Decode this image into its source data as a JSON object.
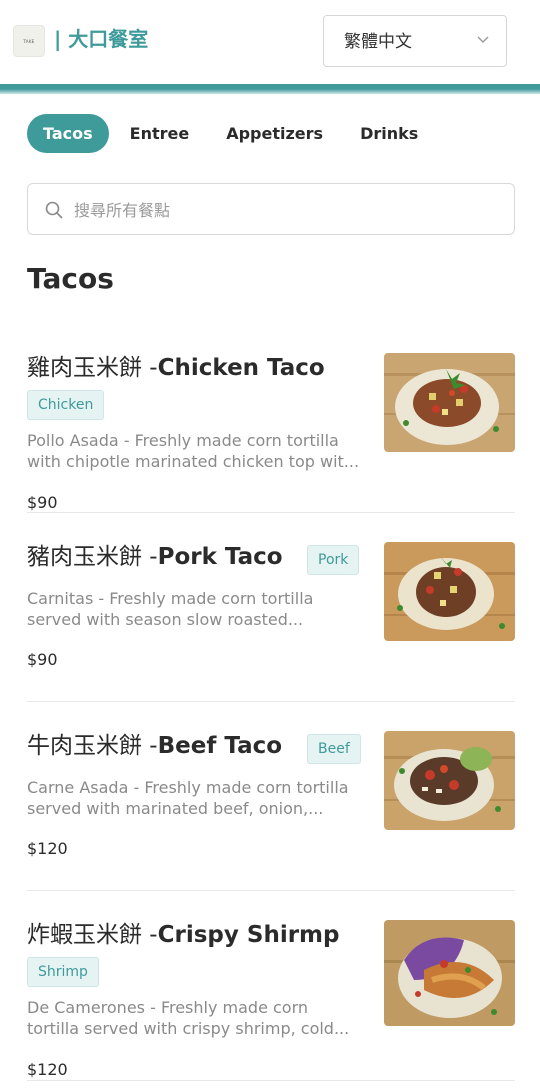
{
  "header": {
    "logo_text": "TAKE",
    "brand": "| 大口餐室",
    "language": "繁體中文"
  },
  "tabs": [
    {
      "label": "Tacos",
      "active": true
    },
    {
      "label": "Entree",
      "active": false
    },
    {
      "label": "Appetizers",
      "active": false
    },
    {
      "label": "Drinks",
      "active": false
    }
  ],
  "search": {
    "placeholder": "搜尋所有餐點",
    "value": ""
  },
  "section": {
    "title": "Tacos"
  },
  "items": [
    {
      "name_zh": "雞肉玉米餅 -",
      "name_en": "Chicken Taco",
      "tag": "Chicken",
      "desc_line1": "Pollo Asada - Freshly made corn tortilla",
      "desc_line2": "with chipotle marinated chicken top wit...",
      "price": "$90",
      "image": "chicken-taco-photo"
    },
    {
      "name_zh": "豬肉玉米餅 -",
      "name_en": "Pork Taco",
      "tag": "Pork",
      "desc_line1": "Carnitas - Freshly made corn tortilla",
      "desc_line2": "served with season slow roasted...",
      "price": "$90",
      "image": "pork-taco-photo"
    },
    {
      "name_zh": "牛肉玉米餅 -",
      "name_en": "Beef Taco",
      "tag": "Beef",
      "desc_line1": "Carne Asada - Freshly made corn tortilla",
      "desc_line2": "served with marinated beef, onion,...",
      "price": "$120",
      "image": "beef-taco-photo"
    },
    {
      "name_zh": "炸蝦玉米餅 -",
      "name_en": "Crispy Shirmp",
      "tag": "Shrimp",
      "desc_line1": "De Camerones - Freshly made corn",
      "desc_line2": "tortilla served with crispy shrimp, cold...",
      "price": "$120",
      "image": "shrimp-taco-photo"
    }
  ],
  "colors": {
    "accent": "#3f9a9a",
    "badge_bg": "#e6f3f3",
    "text": "#2b2b2b",
    "muted": "#8a8a8a"
  }
}
